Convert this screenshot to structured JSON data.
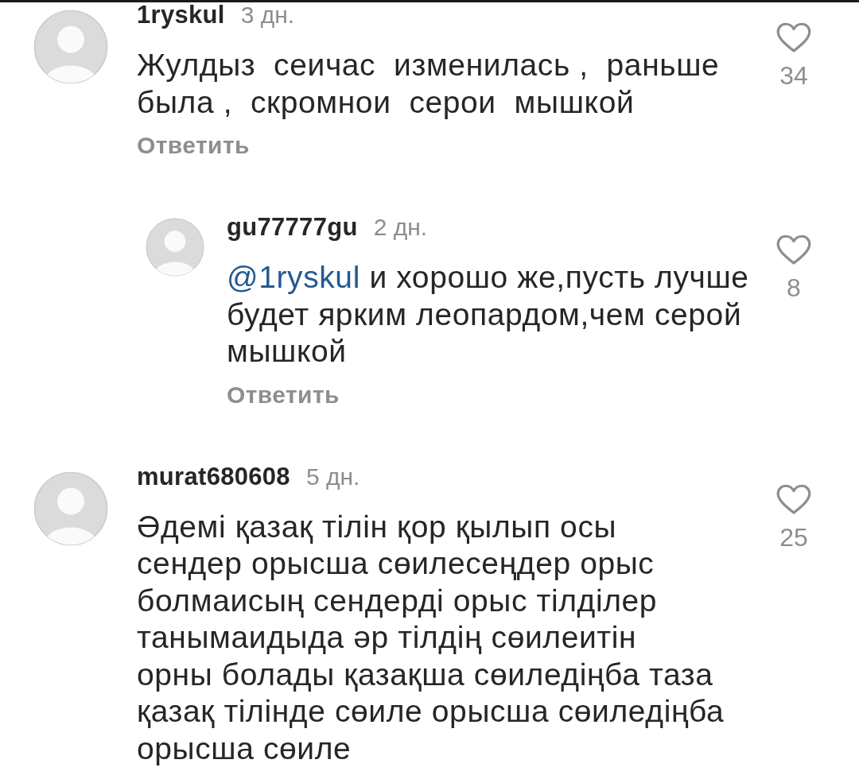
{
  "comments": [
    {
      "username": "1ryskul",
      "time": "3 дн.",
      "text": "Жулдыз  сеичас  изменилась ,  раньше\nбыла ,  скромнои  серои  мышкой",
      "liked": false,
      "likes": "34",
      "reply_label": "Ответить",
      "replies": [
        {
          "username": "gu77777gu",
          "time": "2 дн.",
          "mention": "@1ryskul",
          "text": "и хорошо же,пусть лучше\nбудет ярким леопардом,чем серой\nмышкой",
          "liked": false,
          "likes": "8",
          "reply_label": "Ответить"
        }
      ]
    },
    {
      "username": "murat680608",
      "time": "5 дн.",
      "text": "Әдемі қазақ тілін қор қылып осы\nсендер орысша сөилесеңдер орыс\nболмаисың сендерді орыс тілділер\nтанымаидыда әр тілдің сөилеитін\nорны болады қазақша сөиледіңба таза\nқазақ тілінде сөиле орысша сөиледіңба\nорысша сөиле",
      "liked": false,
      "likes": "25"
    }
  ]
}
